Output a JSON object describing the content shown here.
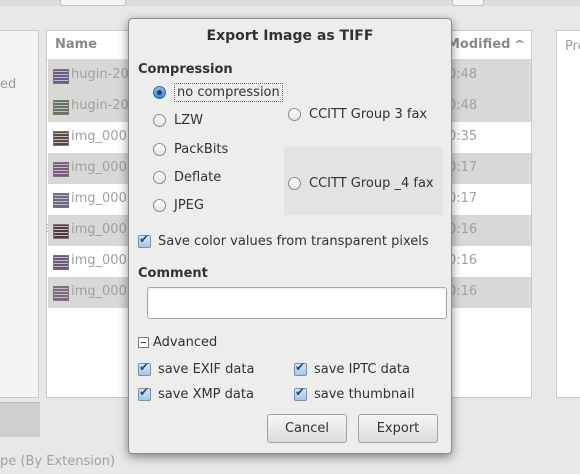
{
  "background": {
    "left_panel_text": "ed",
    "list_header": {
      "name": "Name",
      "modified": "Modified",
      "sort_arrow": "^"
    },
    "files": [
      {
        "name": "hugin-20",
        "time": "0:48",
        "shaded": true
      },
      {
        "name": "hugin-20",
        "time": "0:48",
        "shaded": true
      },
      {
        "name": "img_000",
        "time": "0:35",
        "shaded": false
      },
      {
        "name": "img_000",
        "time": "0:17",
        "shaded": true
      },
      {
        "name": "img_000",
        "time": "0:17",
        "shaded": false
      },
      {
        "name": "img_000",
        "time": "0:16",
        "shaded": true
      },
      {
        "name": "img_000",
        "time": "0:16",
        "shaded": false
      },
      {
        "name": "img_000",
        "time": "0:16",
        "shaded": true
      }
    ],
    "right_panel_text": "Pre",
    "filter_label": "pe (By Extension)"
  },
  "dialog": {
    "title": "Export Image as TIFF",
    "compression_label": "Compression",
    "compression_options": [
      {
        "label": "no compression",
        "selected": true
      },
      {
        "label": "LZW",
        "selected": false
      },
      {
        "label": "PackBits",
        "selected": false
      },
      {
        "label": "Deflate",
        "selected": false
      },
      {
        "label": "JPEG",
        "selected": false
      },
      {
        "label": "CCITT Group 3 fax",
        "selected": false
      },
      {
        "label": "CCITT Group _4 fax",
        "selected": false
      }
    ],
    "save_transparent_label": "Save color values from transparent pixels",
    "save_transparent_checked": true,
    "comment_label": "Comment",
    "comment_value": "",
    "advanced_label": "Advanced",
    "advanced_options": {
      "exif": {
        "label": "save EXIF data",
        "checked": true
      },
      "iptc": {
        "label": "save IPTC data",
        "checked": true
      },
      "xmp": {
        "label": "save XMP data",
        "checked": true
      },
      "thumbnail": {
        "label": "save thumbnail",
        "checked": true
      }
    },
    "cancel_label": "Cancel",
    "export_label": "Export"
  },
  "colors": {
    "accent": "#3b82cc",
    "dialog_bg": "#ededec",
    "row_shade": "#d8d8d7"
  },
  "icons": {
    "file_thumb": "image-thumbnail-icon",
    "checkmark": "checkmark-icon",
    "radio": "radio-icon",
    "expander": "collapse-icon"
  }
}
